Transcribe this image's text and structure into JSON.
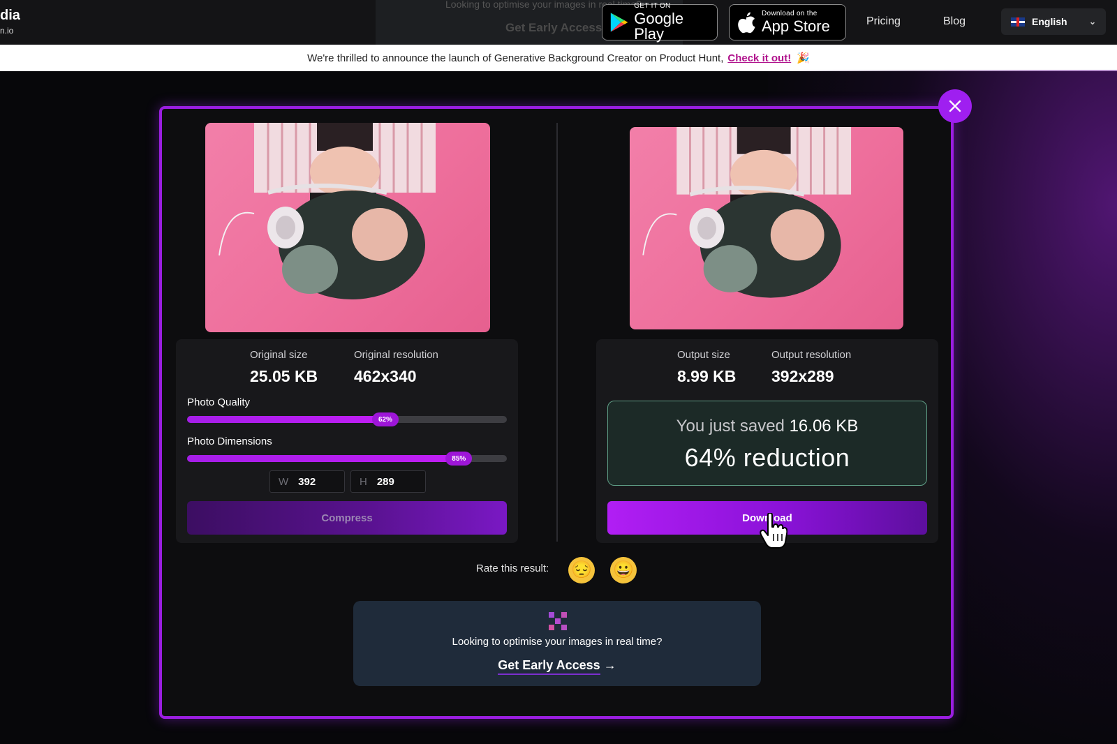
{
  "header": {
    "logo_line1": "dia",
    "logo_line2": "n.io",
    "ghost_text": "Looking to optimise your images in real time?",
    "ghost_cta": "Get Early Access",
    "google_play": {
      "small": "GET IT ON",
      "big": "Google Play"
    },
    "app_store": {
      "small": "Download on the",
      "big": "App Store"
    },
    "nav": [
      "Pricing",
      "Blog"
    ],
    "language": "English"
  },
  "announcement": {
    "text": "We're thrilled to announce the launch of Generative Background Creator on Product Hunt,",
    "link": "Check it out!",
    "emoji": "🎉"
  },
  "original": {
    "size_label": "Original size",
    "size_value": "25.05 KB",
    "res_label": "Original resolution",
    "res_value": "462x340",
    "quality_label": "Photo Quality",
    "quality_percent": 62,
    "quality_text": "62%",
    "dimensions_label": "Photo Dimensions",
    "dimensions_percent": 85,
    "dimensions_text": "85%",
    "width_key": "W",
    "width_value": "392",
    "height_key": "H",
    "height_value": "289",
    "compress_label": "Compress"
  },
  "output": {
    "size_label": "Output size",
    "size_value": "8.99 KB",
    "res_label": "Output resolution",
    "res_value": "392x289",
    "saved_prefix": "You just saved",
    "saved_amount": "16.06 KB",
    "reduction": "64% reduction",
    "download_label": "Download"
  },
  "rating": {
    "label": "Rate this result:",
    "sad": "😔",
    "happy": "😀"
  },
  "promo": {
    "question": "Looking to optimise your images in real time?",
    "cta": "Get Early Access",
    "arrow": "→"
  },
  "colors": {
    "accent": "#9f1ff0",
    "saved_border": "#5f9e86",
    "promo_bg": "#1f2b3a"
  }
}
